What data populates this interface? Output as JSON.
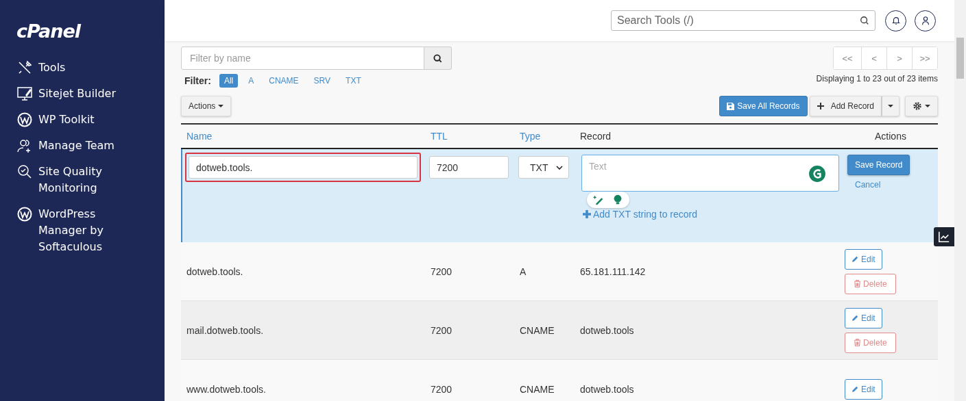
{
  "sidebar": {
    "logo": "cPanel",
    "items": [
      {
        "label": "Tools",
        "kind": "tools"
      },
      {
        "label": "Sitejet Builder",
        "kind": "builder"
      },
      {
        "label": "WP Toolkit",
        "kind": "wordpress"
      },
      {
        "label": "Manage Team",
        "kind": "team"
      },
      {
        "label": "Site Quality Monitoring",
        "kind": "quality"
      },
      {
        "label": "WordPress Manager by Softaculous",
        "kind": "wordpress"
      }
    ]
  },
  "header": {
    "search": {
      "placeholder": "Search Tools (/)"
    }
  },
  "filter_field": {
    "placeholder": "Filter by name"
  },
  "filter": {
    "label": "Filter:",
    "options": [
      {
        "label": "All",
        "selected": true
      },
      {
        "label": "A",
        "selected": false
      },
      {
        "label": "CNAME",
        "selected": false
      },
      {
        "label": "SRV",
        "selected": false
      },
      {
        "label": "TXT",
        "selected": false
      }
    ]
  },
  "pagination": {
    "buttons": [
      "<<",
      "<",
      ">",
      ">>"
    ],
    "summary": "Displaying 1 to 23 out of 23 items"
  },
  "toolbar": {
    "actions": "Actions",
    "save_all": "Save All Records",
    "add_record": "Add Record"
  },
  "table": {
    "columns": [
      {
        "label": "Name",
        "sortable": true
      },
      {
        "label": "TTL",
        "sortable": true
      },
      {
        "label": "Type",
        "sortable": true
      },
      {
        "label": "Record",
        "sortable": false
      },
      {
        "label": "Actions",
        "sortable": false
      }
    ],
    "edit_row": {
      "name": {
        "value": "dotweb.tools.",
        "highlighted": true
      },
      "ttl": {
        "value": "7200"
      },
      "type": {
        "value": "TXT"
      },
      "record": {
        "placeholder": "Text"
      },
      "add_string": "Add TXT string to record",
      "save": "Save Record",
      "cancel": "Cancel"
    },
    "rows": [
      {
        "name": "dotweb.tools.",
        "ttl": "7200",
        "type": "A",
        "record": "65.181.111.142",
        "edit": "Edit",
        "delete": "Delete"
      },
      {
        "name": "mail.dotweb.tools.",
        "ttl": "7200",
        "type": "CNAME",
        "record": "dotweb.tools",
        "edit": "Edit",
        "delete": "Delete"
      },
      {
        "name": "www.dotweb.tools.",
        "ttl": "7200",
        "type": "CNAME",
        "record": "dotweb.tools",
        "edit": "Edit"
      }
    ]
  }
}
